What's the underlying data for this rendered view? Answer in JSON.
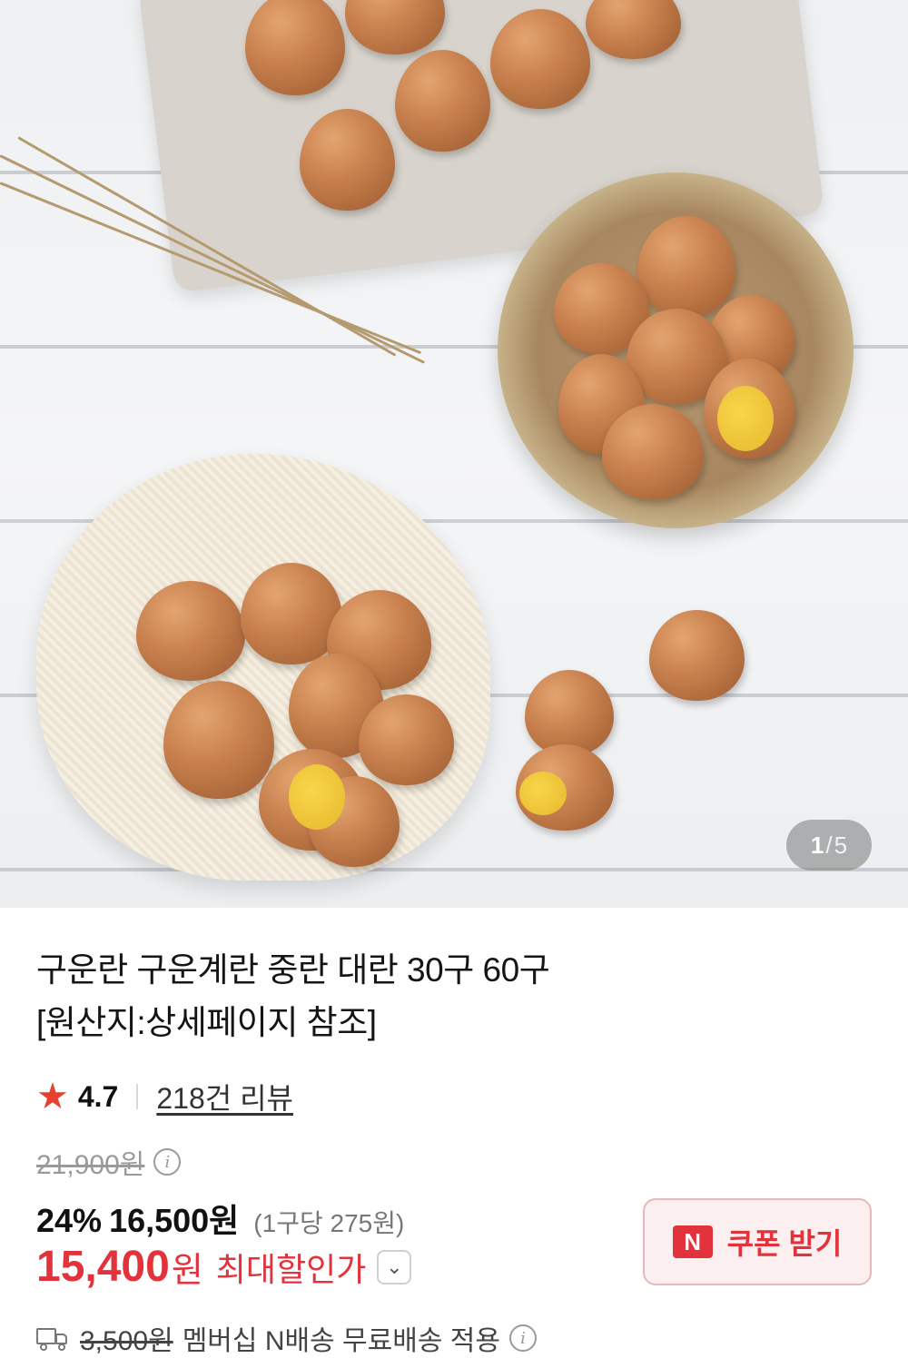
{
  "gallery": {
    "current": "1",
    "separator": "/",
    "total": "5"
  },
  "product": {
    "title_line1": "구운란 구운계란 중란 대란 30구 60구",
    "title_line2": "[원산지:상세페이지 참조]"
  },
  "rating": {
    "value": "4.7",
    "reviews": "218건 리뷰",
    "icon": "star-icon",
    "star_color": "#e8402e"
  },
  "pricing": {
    "original_price": "21,900원",
    "discount_percent": "24%",
    "sale_price": "16,500원",
    "unit_price": "(1구당 275원)",
    "final_price": "15,400",
    "final_price_unit": "원",
    "max_discount_label": "최대할인가",
    "accent_color": "#e2333d"
  },
  "coupon": {
    "logo": "N",
    "label": "쿠폰 받기"
  },
  "shipping": {
    "icon": "truck-icon",
    "original_fee": "3,500원",
    "description": "멤버십 N배송 무료배송 적용"
  }
}
